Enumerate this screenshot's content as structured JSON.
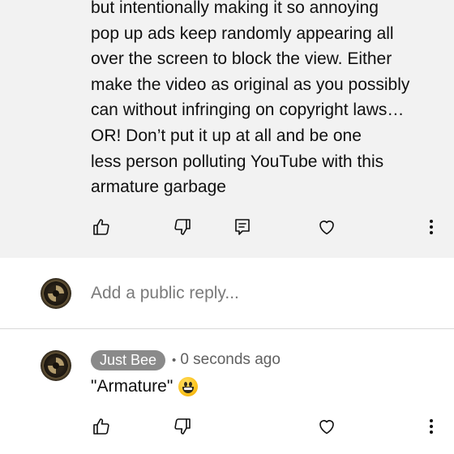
{
  "parent_comment": {
    "lines": [
      "but intentionally making it so annoying",
      "pop up ads keep randomly appearing all",
      "over the screen to block the view. Either",
      "make the video as original as you possibly",
      "can without infringing on copyright laws…",
      "OR! Don’t put it up at all and be one",
      "less person polluting YouTube with this",
      "armature garbage"
    ],
    "actions": {
      "like_icon": "thumbs-up-icon",
      "dislike_icon": "thumbs-down-icon",
      "reply_icon": "reply-comment-icon",
      "heart_icon": "heart-icon",
      "more_icon": "more-vertical-icon"
    }
  },
  "reply_box": {
    "placeholder": "Add a public reply..."
  },
  "reply": {
    "author": "Just Bee",
    "separator": "•",
    "timestamp": "0 seconds ago",
    "text": "\"Armature\"",
    "emoji": "grinning-face-emoji",
    "actions": {
      "like_icon": "thumbs-up-icon",
      "dislike_icon": "thumbs-down-icon",
      "heart_icon": "heart-icon",
      "more_icon": "more-vertical-icon"
    }
  },
  "colors": {
    "background": "#ffffff",
    "comment_bg": "#f2f2f2",
    "author_chip": "#8a8a8a",
    "text": "#0f0f0f",
    "muted": "#606060"
  }
}
